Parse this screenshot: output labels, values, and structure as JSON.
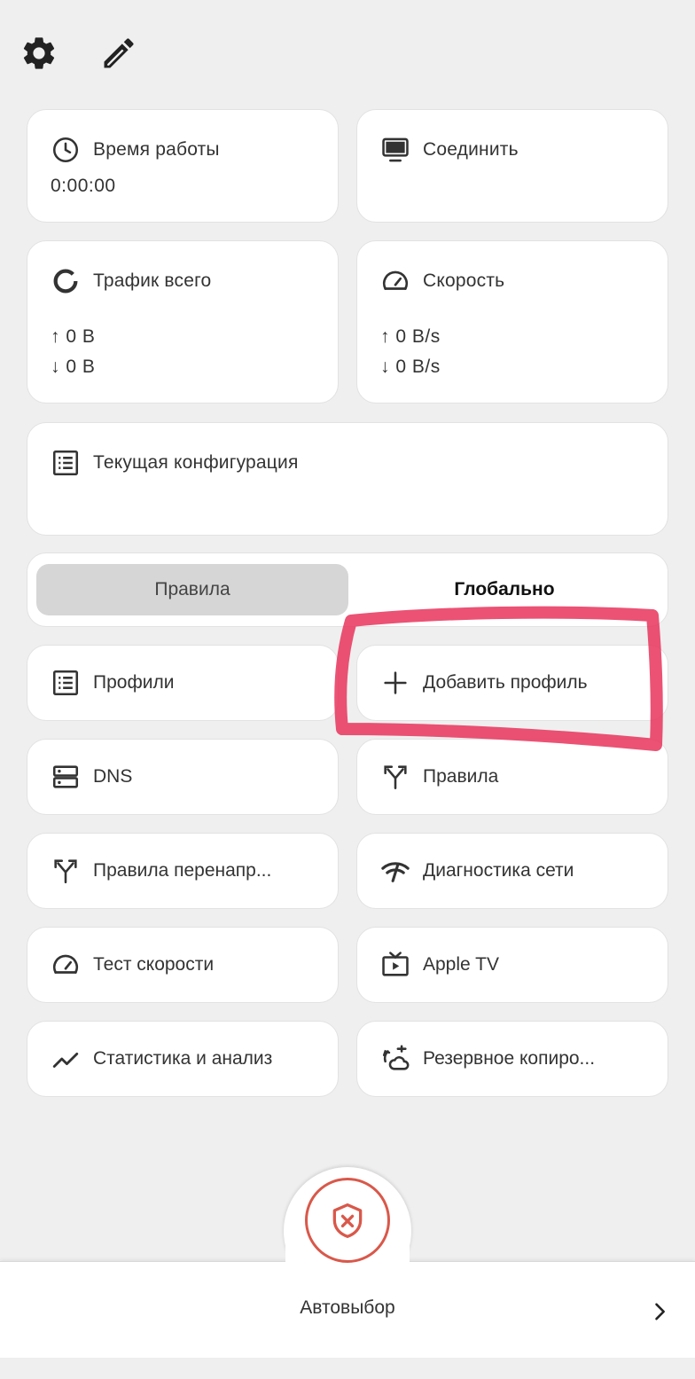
{
  "top_icons": {
    "settings": "gear-icon",
    "edit": "pencil-icon"
  },
  "uptime": {
    "title": "Время работы",
    "value": "0:00:00"
  },
  "connect": {
    "title": "Соединить"
  },
  "traffic": {
    "title": "Трафик всего",
    "up": "↑ 0 B",
    "down": "↓ 0 B"
  },
  "speed": {
    "title": "Скорость",
    "up": "↑ 0 B/s",
    "down": "↓ 0 B/s"
  },
  "config": {
    "title": "Текущая конфигурация"
  },
  "mode": {
    "active": "Правила",
    "inactive": "Глобально"
  },
  "tiles": {
    "profiles": "Профили",
    "add_profile": "Добавить профиль",
    "dns": "DNS",
    "rules": "Правила",
    "redirect_rules": "Правила перенапр...",
    "diagnostics": "Диагностика сети",
    "speed_test": "Тест скорости",
    "apple_tv": "Apple TV",
    "stats": "Статистика и анализ",
    "backup": "Резервное копиро..."
  },
  "bottom": {
    "label": "Автовыбор"
  },
  "colors": {
    "accent": "#d9584a",
    "highlight": "#e8345c",
    "background": "#efefef"
  }
}
